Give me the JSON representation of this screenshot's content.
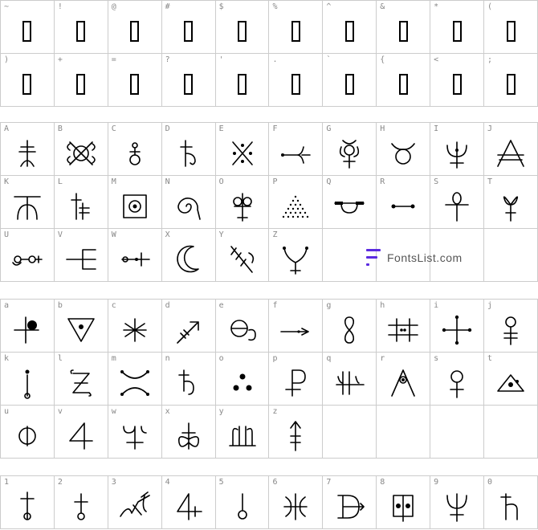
{
  "watermark": "FontsList.com",
  "sections": [
    {
      "cells": [
        {
          "k": "~",
          "g": "tofu"
        },
        {
          "k": "!",
          "g": "tofu"
        },
        {
          "k": "@",
          "g": "tofu"
        },
        {
          "k": "#",
          "g": "tofu"
        },
        {
          "k": "$",
          "g": "tofu"
        },
        {
          "k": "%",
          "g": "tofu"
        },
        {
          "k": "^",
          "g": "tofu"
        },
        {
          "k": "&",
          "g": "tofu"
        },
        {
          "k": "*",
          "g": "tofu"
        },
        {
          "k": "(",
          "g": "tofu"
        },
        {
          "k": ")",
          "g": "tofu"
        },
        {
          "k": "+",
          "g": "tofu"
        },
        {
          "k": "=",
          "g": "tofu"
        },
        {
          "k": "?",
          "g": "tofu"
        },
        {
          "k": "'",
          "g": "tofu"
        },
        {
          "k": ".",
          "g": "tofu"
        },
        {
          "k": "`",
          "g": "tofu"
        },
        {
          "k": "{",
          "g": "tofu"
        },
        {
          "k": "<",
          "g": "tofu"
        },
        {
          "k": ";",
          "g": "tofu"
        }
      ]
    },
    {
      "cells": [
        {
          "k": "A",
          "g": "a-cross-bars"
        },
        {
          "k": "B",
          "g": "b-x-circle"
        },
        {
          "k": "C",
          "g": "c-circles"
        },
        {
          "k": "D",
          "g": "d-cross-hook"
        },
        {
          "k": "E",
          "g": "e-x-dots"
        },
        {
          "k": "F",
          "g": "f-fork"
        },
        {
          "k": "G",
          "g": "mercury"
        },
        {
          "k": "H",
          "g": "taurus"
        },
        {
          "k": "I",
          "g": "i-cup"
        },
        {
          "k": "J",
          "g": "j-triangle"
        },
        {
          "k": "K",
          "g": "k-arch"
        },
        {
          "k": "L",
          "g": "l-h-cross"
        },
        {
          "k": "M",
          "g": "m-box"
        },
        {
          "k": "N",
          "g": "n-spiral"
        },
        {
          "k": "O",
          "g": "o-cross-circles"
        },
        {
          "k": "P",
          "g": "p-dot-tri"
        },
        {
          "k": "Q",
          "g": "q-bowl"
        },
        {
          "k": "R",
          "g": "r-line-dots"
        },
        {
          "k": "S",
          "g": "s-ankh"
        },
        {
          "k": "T",
          "g": "t-loops"
        },
        {
          "k": "U",
          "g": "u-circles"
        },
        {
          "k": "V",
          "g": "v-comb"
        },
        {
          "k": "W",
          "g": "w-line-cross"
        },
        {
          "k": "X",
          "g": "moon"
        },
        {
          "k": "Y",
          "g": "y-scythe"
        },
        {
          "k": "Z",
          "g": "z-fork"
        },
        {
          "k": "",
          "g": ""
        },
        {
          "k": "",
          "g": ""
        },
        {
          "k": "",
          "g": ""
        },
        {
          "k": "",
          "g": ""
        }
      ]
    },
    {
      "cells": [
        {
          "k": "a",
          "g": "a-cross-dot"
        },
        {
          "k": "b",
          "g": "b-triangle-dot"
        },
        {
          "k": "c",
          "g": "asterisk"
        },
        {
          "k": "d",
          "g": "sagittarius"
        },
        {
          "k": "e",
          "g": "e-theta"
        },
        {
          "k": "f",
          "g": "arrow-right"
        },
        {
          "k": "g",
          "g": "figure8"
        },
        {
          "k": "h",
          "g": "h-hash"
        },
        {
          "k": "i",
          "g": "i-cross-dots"
        },
        {
          "k": "j",
          "g": "venus-cross"
        },
        {
          "k": "k",
          "g": "k-stick"
        },
        {
          "k": "l",
          "g": "l-z"
        },
        {
          "k": "m",
          "g": "m-curves"
        },
        {
          "k": "n",
          "g": "saturn"
        },
        {
          "k": "o",
          "g": "three-dots"
        },
        {
          "k": "p",
          "g": "p-p"
        },
        {
          "k": "q",
          "g": "q-trident"
        },
        {
          "k": "r",
          "g": "r-compass"
        },
        {
          "k": "s",
          "g": "venus"
        },
        {
          "k": "t",
          "g": "t-triangle"
        },
        {
          "k": "u",
          "g": "u-circle-line"
        },
        {
          "k": "v",
          "g": "four"
        },
        {
          "k": "w",
          "g": "w-trident"
        },
        {
          "k": "x",
          "g": "x-loops"
        },
        {
          "k": "y",
          "g": "y-lines"
        },
        {
          "k": "z",
          "g": "z-arrow"
        },
        {
          "k": "",
          "g": ""
        },
        {
          "k": "",
          "g": ""
        },
        {
          "k": "",
          "g": ""
        },
        {
          "k": "",
          "g": ""
        }
      ]
    },
    {
      "cells": [
        {
          "k": "1",
          "g": "one-cross"
        },
        {
          "k": "2",
          "g": "two-cross"
        },
        {
          "k": "3",
          "g": "three-scrawl"
        },
        {
          "k": "4",
          "g": "four-b"
        },
        {
          "k": "5",
          "g": "five-circle"
        },
        {
          "k": "6",
          "g": "six-ornament"
        },
        {
          "k": "7",
          "g": "seven-d"
        },
        {
          "k": "8",
          "g": "eight-box"
        },
        {
          "k": "9",
          "g": "neptune"
        },
        {
          "k": "0",
          "g": "zero-h"
        }
      ]
    }
  ]
}
